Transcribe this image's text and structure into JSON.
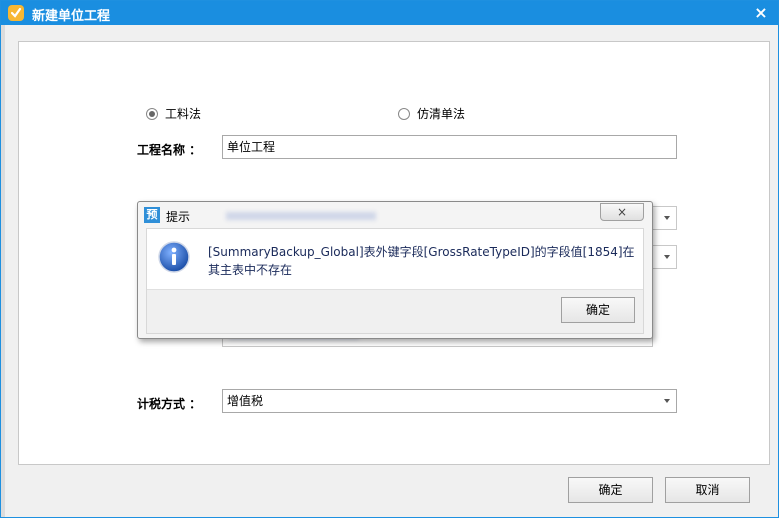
{
  "window": {
    "title": "新建单位工程",
    "close_label": "×"
  },
  "form": {
    "method_options": [
      {
        "label": "工料法",
        "checked": true
      },
      {
        "label": "仿清单法",
        "checked": false
      }
    ],
    "project_name_label": "工程名称 ：",
    "project_name_value": "单位工程",
    "tax_method_label": "计税方式 ：",
    "tax_method_value": "增值税"
  },
  "footer": {
    "ok_label": "确定",
    "cancel_label": "取消"
  },
  "dialog": {
    "title": "提示",
    "title_icon_char": "预",
    "close_label": "×",
    "message": "[SummaryBackup_Global]表外键字段[GrossRateTypeID]的字段值[1854]在其主表中不存在",
    "ok_label": "确定",
    "icon": "info-icon"
  },
  "colors": {
    "titlebar": "#1a8ee0",
    "info_icon": "#2a5fb0"
  }
}
